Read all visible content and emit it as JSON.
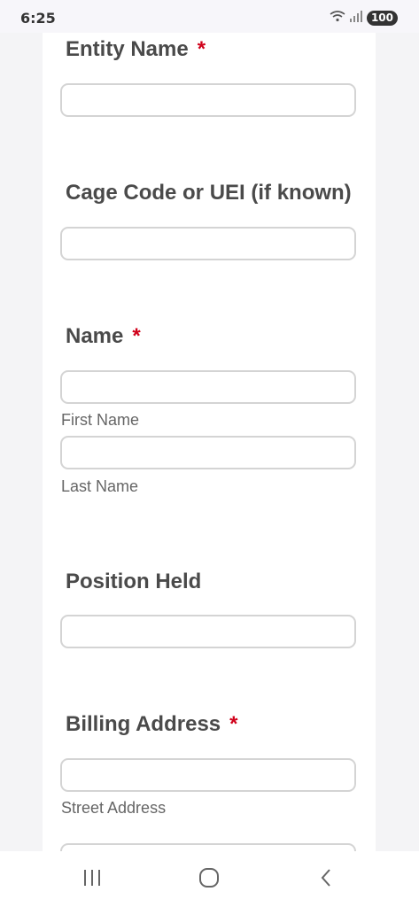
{
  "status_bar": {
    "time": "6:25",
    "battery": "100",
    "wifi_icon": "wifi-icon",
    "signal_icon": "signal-icon"
  },
  "form": {
    "entity_name": {
      "label": "Entity Name",
      "required": "*",
      "value": ""
    },
    "cage_code": {
      "label": "Cage Code or UEI (if known)",
      "value": ""
    },
    "name": {
      "label": "Name",
      "required": "*",
      "first_name_sublabel": "First Name",
      "last_name_sublabel": "Last Name",
      "first_value": "",
      "last_value": ""
    },
    "position_held": {
      "label": "Position Held",
      "value": ""
    },
    "billing_address": {
      "label": "Billing Address",
      "required": "*",
      "street_sublabel": "Street Address",
      "street_value": ""
    }
  },
  "nav_bar": {
    "recents_icon": "recents-icon",
    "home_icon": "home-icon",
    "back_icon": "back-icon"
  },
  "colors": {
    "required": "#d0021b",
    "label": "#4a4a4a",
    "border": "#d4d4d4",
    "page_bg": "#f4f4f6"
  }
}
